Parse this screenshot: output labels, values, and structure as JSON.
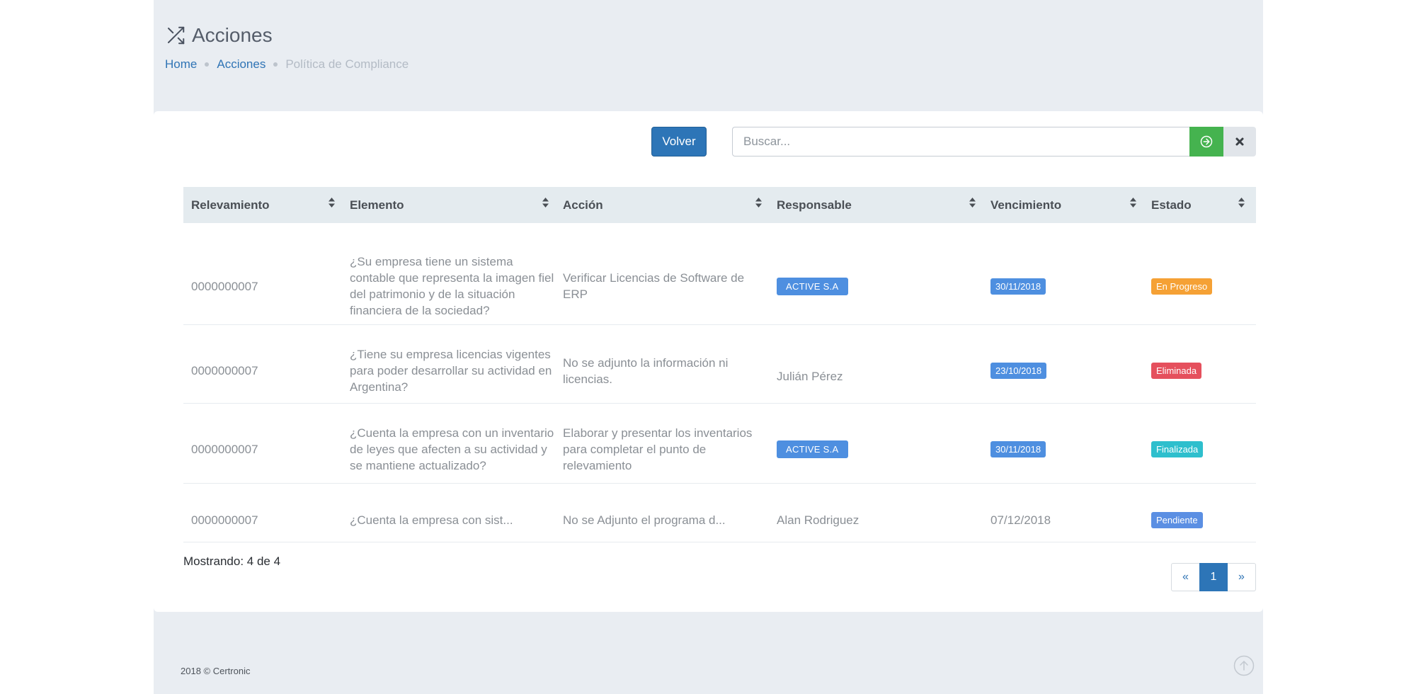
{
  "header": {
    "title": "Acciones",
    "title_icon": "shuffle-icon",
    "breadcrumb": [
      {
        "label": "Home"
      },
      {
        "label": "Acciones"
      },
      {
        "label": "Política de Compliance"
      }
    ]
  },
  "toolbar": {
    "back_label": "Volver",
    "search_placeholder": "Buscar...",
    "search_value": "",
    "search_go_icon": "arrow-circle-right-icon",
    "search_clear_icon": "close-icon"
  },
  "table": {
    "columns": [
      "Relevamiento",
      "Elemento",
      "Acción",
      "Responsable",
      "Vencimiento",
      "Estado"
    ],
    "rows": [
      {
        "relevamiento": "0000000007",
        "elemento": "¿Su empresa tiene un sistema contable que representa la imagen fiel del patrimonio y de la situación financiera de la sociedad?",
        "accion": "Verificar Licencias de Software de ERP",
        "responsable": "ACTIVE S.A",
        "vencimiento": "30/11/2018",
        "estado": "En Progreso"
      },
      {
        "relevamiento": "0000000007",
        "elemento": "¿Tiene su empresa licencias vigentes para poder desarrollar su actividad en Argentina?",
        "accion": "No se adjunto la información ni licencias.",
        "responsable": "Julián Pérez",
        "vencimiento": "23/10/2018",
        "estado": "Eliminada"
      },
      {
        "relevamiento": "0000000007",
        "elemento": "¿Cuenta la empresa con un inventario de leyes que afecten a su actividad y se mantiene actualizado?",
        "accion": "Elaborar y presentar los inventarios para completar el punto de relevamiento",
        "responsable": "ACTIVE S.A",
        "vencimiento": "30/11/2018",
        "estado": "Finalizada"
      },
      {
        "relevamiento": "0000000007",
        "elemento": "¿Cuenta la empresa con sist...",
        "accion": "No se Adjunto el programa d...",
        "responsable": "Alan Rodriguez",
        "vencimiento": "07/12/2018",
        "estado": "Pendiente"
      }
    ]
  },
  "status_colors": {
    "En Progreso": "#f5a135",
    "Eliminada": "#e5505d",
    "Finalizada": "#2ebfcd",
    "Pendiente": "#5b8fe3",
    "badge_blue": "#4e8fe0"
  },
  "footer_info": {
    "showing": "Mostrando: 4 de 4"
  },
  "pagination": {
    "prev": "«",
    "current": "1",
    "next": "»"
  },
  "footer": {
    "copyright": "2018 © Certronic",
    "scroll_top_icon": "arrow-up-circle-icon"
  }
}
